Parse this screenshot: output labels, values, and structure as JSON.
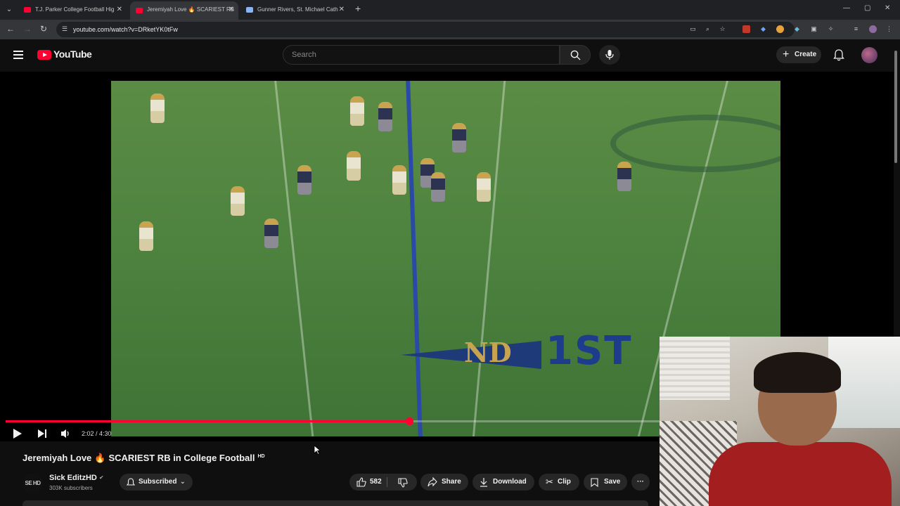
{
  "browser": {
    "tabs": [
      {
        "title": "T.J. Parker College Football Hig",
        "active": false
      },
      {
        "title": "Jeremiyah Love 🔥 SCARIEST RB",
        "active": true
      },
      {
        "title": "Gunner Rivers, St. Michael Cath",
        "active": false
      }
    ],
    "url": "youtube.com/watch?v=DRketYK0tFw",
    "new_tab_label": "+",
    "tab_close": "✕",
    "win_min": "—",
    "win_max": "▢",
    "win_close": "✕"
  },
  "youtube": {
    "logo_text": "YouTube",
    "search_placeholder": "Search",
    "create_label": "Create",
    "create_plus": "+"
  },
  "player": {
    "current_time": "2:02",
    "duration": "4:30",
    "time_display": "2:02 / 4:30",
    "progress_fraction": 0.452,
    "buffered_fraction": 0.86
  },
  "video": {
    "field_text": "1ST",
    "field_logo": "ND",
    "title": "Jeremiyah Love",
    "title_emoji": "🔥",
    "title_rest": "SCARIEST RB in College Football",
    "hd_badge": "HD"
  },
  "channel": {
    "name": "Sick EditzHD",
    "subscribers": "303K subscribers",
    "avatar_text": "SE HD",
    "verified_icon": "✔",
    "subscribe_label": "Subscribed"
  },
  "actions": {
    "like_count": "582",
    "share_label": "Share",
    "download_label": "Download",
    "clip_label": "Clip",
    "save_label": "Save",
    "more_label": "···"
  },
  "colors": {
    "accent": "#ff0033",
    "background": "#0f0f0f",
    "pill": "#272727"
  }
}
